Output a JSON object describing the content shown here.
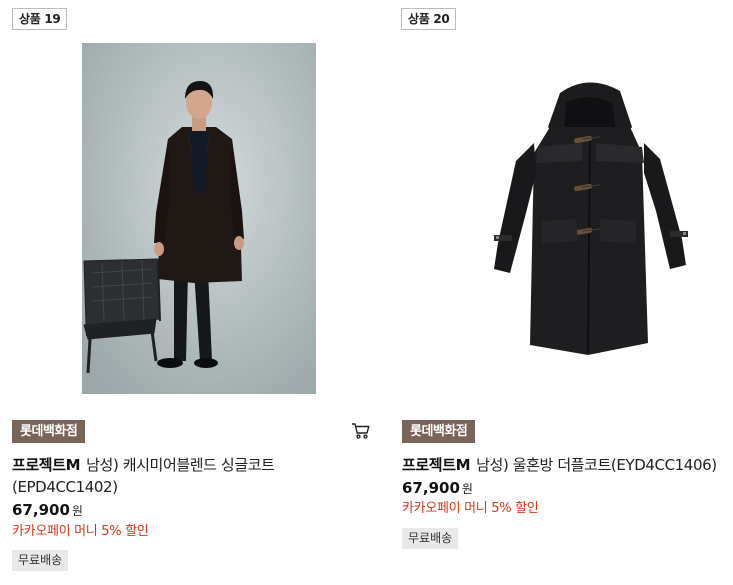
{
  "products": [
    {
      "number_label": "상품 19",
      "image_alt": "model wearing charcoal cashmere blend single coat",
      "store": "롯데백화점",
      "brand": "프로젝트M",
      "name_line1": "남성) 캐시미어블렌드 싱글코트",
      "name_line2": "(EPD4CC1402)",
      "price": "67,900",
      "currency": "원",
      "promo": "카카오페이 머니 5% 할인",
      "shipping": "무료배송",
      "cart_icon": "shopping-cart-icon"
    },
    {
      "number_label": "상품 20",
      "image_alt": "black wool duffle coat",
      "store": "롯데백화점",
      "brand": "프로젝트M",
      "name_line1": "남성) 울혼방 더플코트(EYD4CC1406)",
      "price": "67,900",
      "currency": "원",
      "promo": "카카오페이 머니 5% 할인",
      "shipping": "무료배송"
    }
  ],
  "colors": {
    "store_badge_bg": "#7a6458",
    "promo_text": "#d3391d",
    "shipping_bg": "#e9e9e9"
  }
}
